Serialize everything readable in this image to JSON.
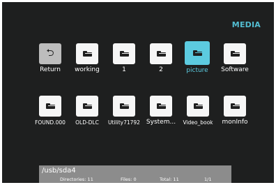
{
  "header": {
    "title": "MEDIA"
  },
  "tiles": [
    {
      "label": "Return",
      "icon": "return-icon"
    },
    {
      "label": "working",
      "icon": "folder-icon"
    },
    {
      "label": "1",
      "icon": "folder-icon"
    },
    {
      "label": "2",
      "icon": "folder-icon"
    },
    {
      "label": "picture",
      "icon": "folder-icon"
    },
    {
      "label": "Software",
      "icon": "folder-icon"
    },
    {
      "label": "FOUND.000",
      "icon": "folder-icon"
    },
    {
      "label": "OLD-DLC",
      "icon": "folder-icon"
    },
    {
      "label": "Utility71792",
      "icon": "folder-icon"
    },
    {
      "label": "System...",
      "icon": "folder-icon"
    },
    {
      "label": "Video_book",
      "icon": "folder-icon"
    },
    {
      "label": "monInfo",
      "icon": "folder-icon"
    }
  ],
  "selected_tile": "picture",
  "status": {
    "path": "/usb/sda4",
    "directories": "Directories: 11",
    "files": "Files: 0",
    "total": "Total: 11",
    "page": "1/1"
  },
  "colors": {
    "background": "#1e1f1f",
    "accent": "#5ccbe0",
    "status_bar": "#8c8c8c"
  }
}
